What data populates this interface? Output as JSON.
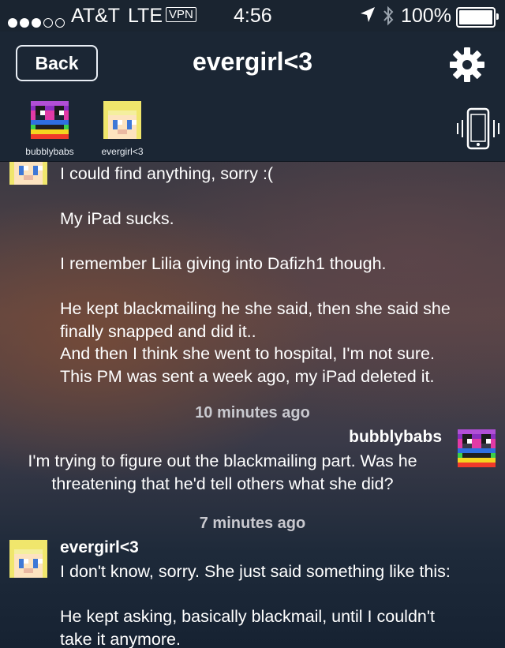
{
  "status_bar": {
    "carrier": "AT&T",
    "network": "LTE",
    "vpn": "VPN",
    "time": "4:56",
    "battery": "100%"
  },
  "nav": {
    "back_label": "Back",
    "title": "evergirl<3",
    "settings_icon": "gear-icon"
  },
  "participants": [
    {
      "name": "bubblybabs",
      "avatar": "rainbow-pixel-avatar"
    },
    {
      "name": "evergirl<3",
      "avatar": "blonde-pixel-avatar"
    }
  ],
  "messages": [
    {
      "lines": [
        "I could find anything, sorry :(",
        "",
        "My iPad sucks.",
        "",
        "I remember Lilia giving into Dafizh1 though.",
        "",
        "He kept blackmailing he she said, then she said she",
        "finally snapped and did it..",
        "And then I think she went to hospital, I'm not sure.",
        "This PM was sent a week ago, my iPad deleted it."
      ]
    },
    {
      "timestamp": "10 minutes ago",
      "sender": "bubblybabs",
      "lines": [
        "I'm trying to figure out the blackmailing part.  Was he",
        "threatening that he'd tell others what she did?"
      ]
    },
    {
      "timestamp": "7 minutes ago",
      "sender": "evergirl<3",
      "lines": [
        "I don't know, sorry. She just said something like this:",
        "",
        "He kept asking, basically blackmail, until I couldn't",
        "take it anymore."
      ]
    }
  ]
}
